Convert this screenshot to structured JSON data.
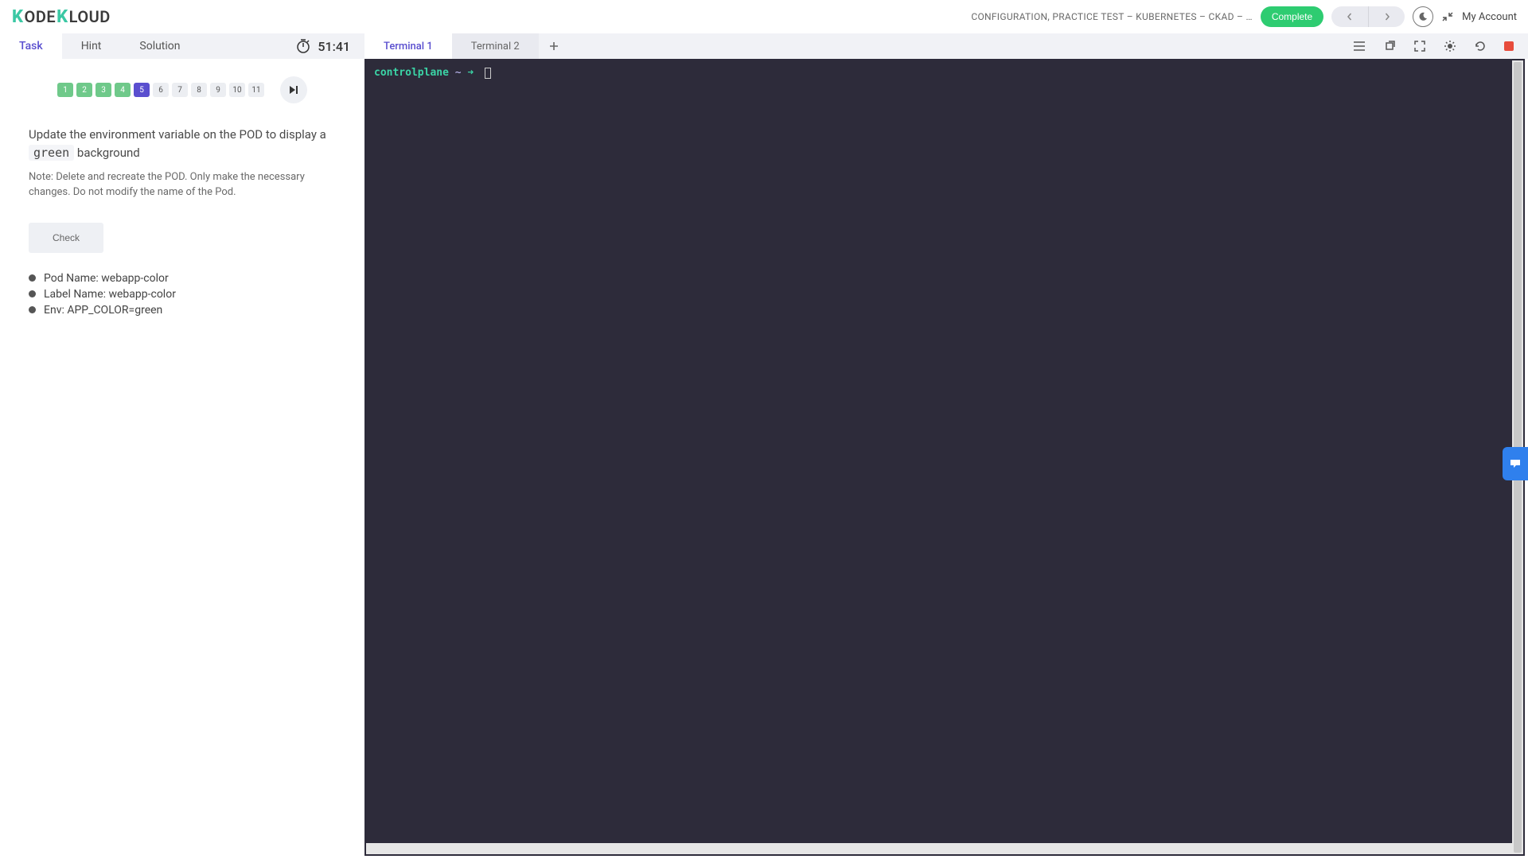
{
  "header": {
    "logo_text": "ODE",
    "logo_text2": "LOUD",
    "breadcrumb": "CONFIGURATION, PRACTICE TEST – KUBERNETES – CKAD – …",
    "complete_label": "Complete",
    "account_label": "My Account"
  },
  "left_tabs": {
    "task": "Task",
    "hint": "Hint",
    "solution": "Solution"
  },
  "timer": "51:41",
  "questions": [
    "1",
    "2",
    "3",
    "4",
    "5",
    "6",
    "7",
    "8",
    "9",
    "10",
    "11"
  ],
  "questions_done_through": 4,
  "questions_current": 5,
  "task": {
    "text_pre": "Update the environment variable on the POD to display a ",
    "code": "green",
    "text_post": " background",
    "note": "Note: Delete and recreate the POD. Only make the necessary changes. Do not modify the name of the Pod.",
    "check_label": "Check",
    "criteria": [
      "Pod Name: webapp-color",
      "Label Name: webapp-color",
      "Env: APP_COLOR=green"
    ]
  },
  "terminal_tabs": {
    "t1": "Terminal 1",
    "t2": "Terminal 2"
  },
  "terminal": {
    "host": "controlplane",
    "path": "~",
    "arrow": "➜"
  }
}
